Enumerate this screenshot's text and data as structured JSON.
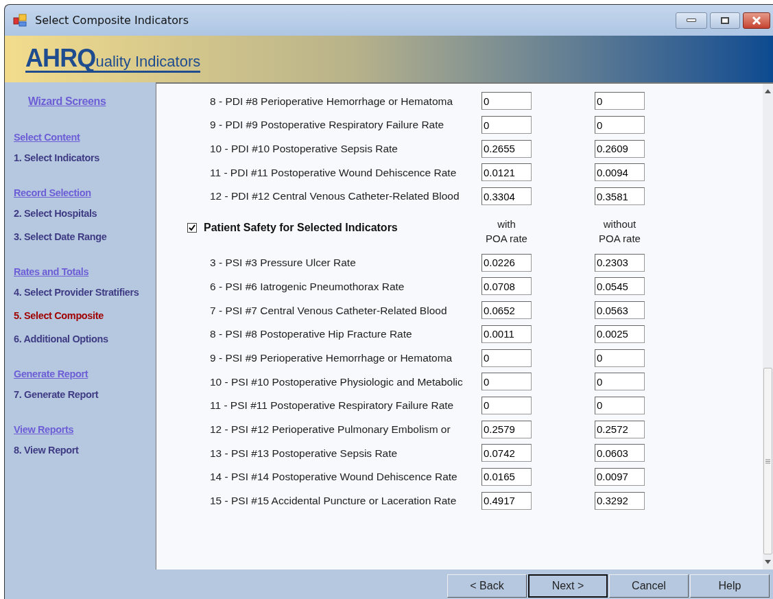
{
  "window": {
    "title": "Select Composite Indicators"
  },
  "banner": {
    "logo_main": "AHRQ",
    "logo_rest": "uality Indicators"
  },
  "sidebar": {
    "title": "Wizard Screens",
    "sections": [
      {
        "heading": "Select Content",
        "items": [
          {
            "label": "1. Select Indicators",
            "selected": false
          }
        ]
      },
      {
        "heading": "Record Selection",
        "items": [
          {
            "label": "2. Select Hospitals",
            "selected": false
          },
          {
            "label": "3. Select Date Range",
            "selected": false
          }
        ]
      },
      {
        "heading": "Rates and Totals",
        "items": [
          {
            "label": "4. Select Provider Stratifiers",
            "selected": false
          },
          {
            "label": "5. Select Composite",
            "selected": true
          },
          {
            "label": "6. Additional Options",
            "selected": false
          }
        ]
      },
      {
        "heading": "Generate Report",
        "items": [
          {
            "label": "7. Generate Report",
            "selected": false
          }
        ]
      },
      {
        "heading": "View Reports",
        "items": [
          {
            "label": "8. View Report",
            "selected": false
          }
        ]
      }
    ]
  },
  "groups": [
    {
      "rows": [
        {
          "label": "8 - PDI #8 Perioperative Hemorrhage or Hematoma",
          "with_poa": "0",
          "without_poa": "0"
        },
        {
          "label": "9 - PDI #9 Postoperative Respiratory Failure Rate",
          "with_poa": "0",
          "without_poa": "0"
        },
        {
          "label": "10 - PDI #10 Postoperative Sepsis Rate",
          "with_poa": "0.2655",
          "without_poa": "0.2609"
        },
        {
          "label": "11 - PDI #11 Postoperative Wound Dehiscence Rate",
          "with_poa": "0.0121",
          "without_poa": "0.0094"
        },
        {
          "label": "12 - PDI #12 Central Venous Catheter-Related Blood",
          "with_poa": "0.3304",
          "without_poa": "0.3581"
        }
      ]
    },
    {
      "header": {
        "label": "Patient Safety for Selected Indicators",
        "checked": true,
        "column_1": "with\nPOA rate",
        "column_2": "without\nPOA rate"
      },
      "rows": [
        {
          "label": "3 - PSI #3 Pressure Ulcer Rate",
          "with_poa": "0.0226",
          "without_poa": "0.2303"
        },
        {
          "label": "6 - PSI #6 Iatrogenic Pneumothorax Rate",
          "with_poa": "0.0708",
          "without_poa": "0.0545"
        },
        {
          "label": "7 - PSI #7 Central Venous Catheter-Related Blood",
          "with_poa": "0.0652",
          "without_poa": "0.0563"
        },
        {
          "label": "8 - PSI #8 Postoperative Hip Fracture Rate",
          "with_poa": "0.0011",
          "without_poa": "0.0025"
        },
        {
          "label": "9 - PSI #9 Perioperative Hemorrhage or Hematoma",
          "with_poa": "0",
          "without_poa": "0"
        },
        {
          "label": "10 - PSI #10 Postoperative Physiologic and Metabolic",
          "with_poa": "0",
          "without_poa": "0"
        },
        {
          "label": "11 - PSI #11 Postoperative Respiratory Failure Rate",
          "with_poa": "0",
          "without_poa": "0"
        },
        {
          "label": "12 - PSI #12 Perioperative Pulmonary Embolism or",
          "with_poa": "0.2579",
          "without_poa": "0.2572"
        },
        {
          "label": "13 - PSI #13 Postoperative Sepsis Rate",
          "with_poa": "0.0742",
          "without_poa": "0.0603"
        },
        {
          "label": "14 - PSI #14 Postoperative Wound Dehiscence Rate",
          "with_poa": "0.0165",
          "without_poa": "0.0097"
        },
        {
          "label": "15 - PSI #15 Accidental Puncture or Laceration Rate",
          "with_poa": "0.4917",
          "without_poa": "0.3292"
        }
      ]
    }
  ],
  "buttons": [
    {
      "label": "< Back",
      "default": false
    },
    {
      "label": "Next >",
      "default": true
    },
    {
      "label": "Cancel",
      "default": false
    },
    {
      "label": "Help",
      "default": false
    }
  ]
}
